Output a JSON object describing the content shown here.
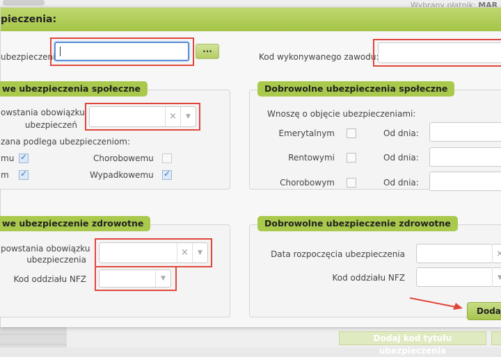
{
  "background": {
    "payer_prefix": "Wybrany płatnik:",
    "payer_value": "MAR",
    "add_title_button": "Dodaj kod tytułu ubezpieczenia"
  },
  "modal": {
    "title": "pieczenia:",
    "insurance_code_label": "ubezpieczenia:",
    "insurance_code_value": "",
    "lookup_button": "...",
    "profession_code_label": "Kod wykonywanego zawodu:",
    "profession_code_value": ""
  },
  "social_mandatory": {
    "title": "we ubezpieczenia społeczne",
    "obligation_label_line1": "owstania obowiązku",
    "obligation_label_line2": "ubezpieczeń",
    "obligation_value": "",
    "subject_label": "zana podlega ubezpieczeniom:",
    "items": [
      {
        "label": "mu",
        "checked": true
      },
      {
        "label": "m",
        "checked": true
      },
      {
        "label": "Chorobowemu",
        "checked": false
      },
      {
        "label": "Wypadkowemu",
        "checked": true
      }
    ]
  },
  "social_voluntary": {
    "title": "Dobrowolne ubezpieczenia społeczne",
    "subject_label": "Wnoszę o objęcie ubezpieczeniami:",
    "from_label": "Od dnia:",
    "rows": [
      {
        "label": "Emerytalnym",
        "checked": false,
        "date": ""
      },
      {
        "label": "Rentowymi",
        "checked": false,
        "date": ""
      },
      {
        "label": "Chorobowym",
        "checked": false,
        "date": ""
      }
    ]
  },
  "health_mandatory": {
    "title": "we ubezpieczenie zdrowotne",
    "obligation_label_line1": "powstania obowiązku",
    "obligation_label_line2": "ubezpieczenia",
    "obligation_value": "",
    "nfz_label": "Kod oddziału NFZ",
    "nfz_value": ""
  },
  "health_voluntary": {
    "title": "Dobrowolne ubezpieczenie zdrowotne",
    "start_label": "Data rozpoczęcia ubezpieczenia",
    "start_value": "",
    "nfz_label": "Kod oddziału NFZ",
    "nfz_value": ""
  },
  "footer": {
    "add_button": "Dodaj"
  },
  "icons": {
    "clear": "×",
    "dropdown": "▼"
  },
  "colors": {
    "accent_green": "#a9c94c",
    "highlight_red": "#e0453a",
    "focus_blue": "#5b8fd6"
  }
}
